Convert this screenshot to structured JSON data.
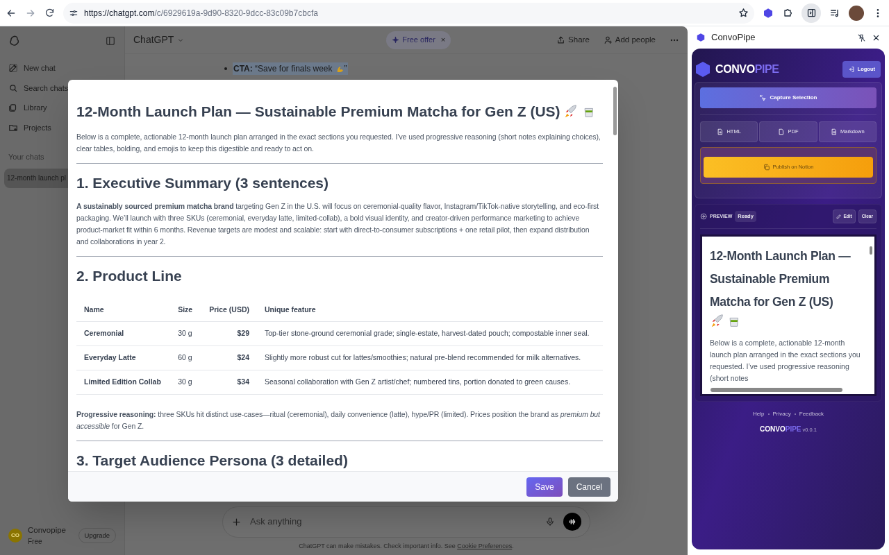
{
  "browser": {
    "url_host": "https://chatgpt.com",
    "url_path": "/c/6929619a-9d90-8320-9dcc-83c09b7cbcfa"
  },
  "sidebar": {
    "items": [
      {
        "label": "New chat",
        "kind": "new"
      },
      {
        "label": "Search chats",
        "kind": "search"
      },
      {
        "label": "Library",
        "kind": "library"
      },
      {
        "label": "Projects",
        "kind": "projects"
      }
    ],
    "section": "Your chats",
    "chats": [
      {
        "label": "12-month launch pl",
        "selected": true
      }
    ],
    "user": {
      "initials": "CO",
      "name": "Convopipe",
      "plan": "Free",
      "upgrade": "Upgrade"
    }
  },
  "header": {
    "model": "ChatGPT",
    "offer": "Free offer",
    "offer_close": "×",
    "share": "Share",
    "add_people": "Add people"
  },
  "chat": {
    "bullet_text": "**CTA:** “Save for finals week",
    "bullet_end": "”"
  },
  "composer": {
    "placeholder": "Ask anything",
    "disclaimer": "ChatGPT can make mistakes. Check important info. See ",
    "disclaimer_link": "Cookie Preferences",
    "disclaimer_end": "."
  },
  "modal": {
    "title": "12-Month Launch Plan — Sustainable Premium Matcha for Gen Z (US)",
    "intro": "Below is a complete, actionable 12-month launch plan arranged in the exact sections you requested. I’ve used progressive reasoning (short notes explaining choices), clear tables, bolding, and emojis to keep this digestible and ready to act on.",
    "sections": [
      {
        "heading": "1. Executive Summary (3 sentences)",
        "paragraph": "**A sustainably sourced premium matcha brand** targeting Gen Z in the U.S. will focus on ceremonial-quality flavor, Instagram/TikTok-native storytelling, and eco-first packaging. We’ll launch with three SKUs (ceremonial, everyday latte, limited-collab), a bold visual identity, and creator-driven performance marketing to achieve product-market fit within 6 months. Revenue targets are modest and scalable: start with direct-to-consumer subscriptions + one retail pilot, then expand distribution and collaborations in year 2."
      },
      {
        "heading": "2. Product Line",
        "table": {
          "columns": [
            "Name",
            "Size",
            "Price (USD)",
            "Unique feature"
          ],
          "rows": [
            [
              "Ceremonial",
              "30 g",
              "$29",
              "Top-tier stone-ground ceremonial grade; single-estate, harvest-dated pouch; compostable inner seal."
            ],
            [
              "Everyday Latte",
              "60 g",
              "$24",
              "Slightly more robust cut for lattes/smoothies; natural pre-blend recommended for milk alternatives."
            ],
            [
              "Limited Edition Collab",
              "30 g",
              "$34",
              "Seasonal collaboration with Gen Z artist/chef; numbered tins, portion donated to green causes."
            ]
          ]
        },
        "paragraph": "**Progressive reasoning:** three SKUs hit distinct use-cases—ritual (ceremonial), daily convenience (latte), hype/PR (limited). Prices position the brand as *premium but accessible* for Gen Z."
      },
      {
        "heading": "3. Target Audience Persona (3 detailed)"
      }
    ],
    "save": "Save",
    "cancel": "Cancel"
  },
  "panel": {
    "title": "ConvoPipe",
    "logo_a": "CONVO",
    "logo_b": "PIPE",
    "logout": "Logout",
    "capture": "Capture Selection",
    "exports": [
      {
        "label": "HTML",
        "kind": "html"
      },
      {
        "label": "PDF",
        "kind": "pdf"
      },
      {
        "label": "Markdown",
        "kind": "markdown"
      }
    ],
    "publish": "Publish on Notion",
    "preview_label": "PREVIEW",
    "preview_status": "Ready",
    "edit": "Edit",
    "clear": "Clear",
    "preview_title": "12-Month Launch Plan — Sustainable Premium Matcha for Gen Z (US)",
    "preview_text": "Below is a complete, actionable 12-month launch plan arranged in the exact sections you requested. I’ve used progressive reasoning (short notes",
    "links": [
      "Help",
      "Privacy",
      "Feedback"
    ],
    "footer_logo_a": "CONVO",
    "footer_logo_b": "PIPE",
    "version": "v0.0.1"
  }
}
